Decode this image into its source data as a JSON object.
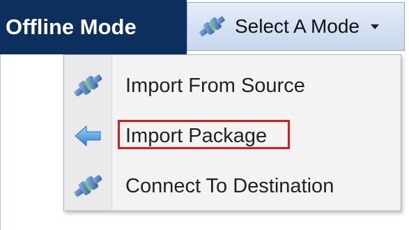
{
  "header": {
    "title": "Offline Mode",
    "select_mode": {
      "label": "Select A Mode",
      "icon": "plug-connector-icon"
    }
  },
  "menu": {
    "items": [
      {
        "label": "Import From Source",
        "icon": "plug-connector-icon"
      },
      {
        "label": "Import Package",
        "icon": "arrow-left-icon",
        "highlighted": true
      },
      {
        "label": "Connect To Destination",
        "icon": "plug-connector-icon"
      }
    ]
  },
  "colors": {
    "title_bg": "#0d2f5e",
    "highlight": "#e01818",
    "icon_blue": "#3a6fb0",
    "icon_green": "#7cc47a"
  }
}
